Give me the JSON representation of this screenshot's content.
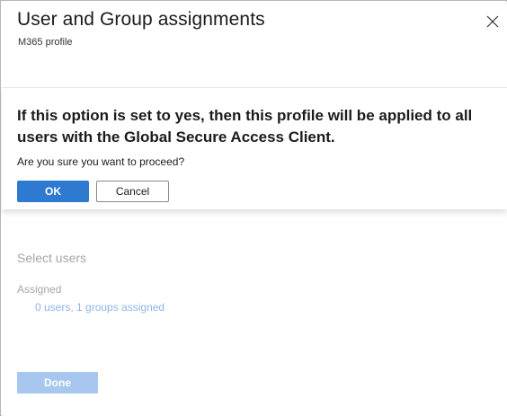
{
  "header": {
    "title": "User and Group assignments",
    "subtitle": "M365 profile",
    "close_icon": "close-icon"
  },
  "dialog": {
    "heading": "If this option is set to yes, then this profile will be applied to all users with the Global Secure Access Client.",
    "question": "Are you sure you want to proceed?",
    "ok_label": "OK",
    "cancel_label": "Cancel"
  },
  "content": {
    "section_heading": "Select users",
    "assigned_label": "Assigned",
    "assigned_link": "0 users, 1 groups assigned",
    "done_label": "Done"
  },
  "colors": {
    "primary": "#2f7ad1",
    "primary_disabled": "#a7c7ee",
    "link_disabled": "#8db6e4",
    "muted_text": "#a6a6a6"
  }
}
